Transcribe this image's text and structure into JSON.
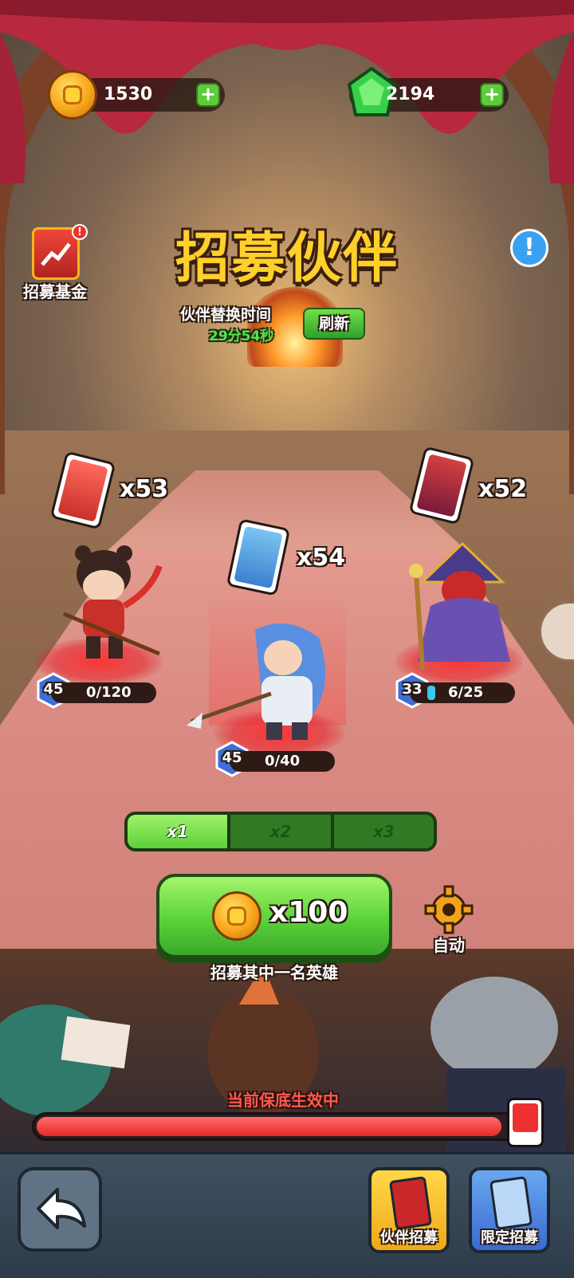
{
  "resources": {
    "coins": "1530",
    "gems": "2194"
  },
  "fund": {
    "label": "招募基金",
    "badge": "!"
  },
  "title": "招募伙伴",
  "refresh": {
    "label": "伙伴替换时间",
    "timer": "29分54秒",
    "button": "刷新"
  },
  "info_icon": "!",
  "heroes": [
    {
      "name": "red-warrior",
      "cards": "x53",
      "level": "45",
      "progress": "0/120",
      "progress_value": 0
    },
    {
      "name": "blue-spearman",
      "cards": "x54",
      "level": "45",
      "progress": "0/40",
      "progress_value": 0
    },
    {
      "name": "red-mask-mage",
      "cards": "x52",
      "level": "33",
      "progress": "6/25",
      "progress_value": 0.24
    }
  ],
  "multipliers": [
    "x1",
    "x2",
    "x3"
  ],
  "selected_multiplier": "x1",
  "recruit": {
    "cost": "x100",
    "caption": "招募其中一名英雄"
  },
  "auto": {
    "label": "自动"
  },
  "guarantee": {
    "label": "当前保底生效中",
    "progress": 0.92
  },
  "bottom_nav": {
    "partner": "伙伴招募",
    "limited": "限定招募"
  },
  "colors": {
    "gold": "#ffd02a",
    "green": "#5bd23a",
    "red": "#e62a2a"
  }
}
